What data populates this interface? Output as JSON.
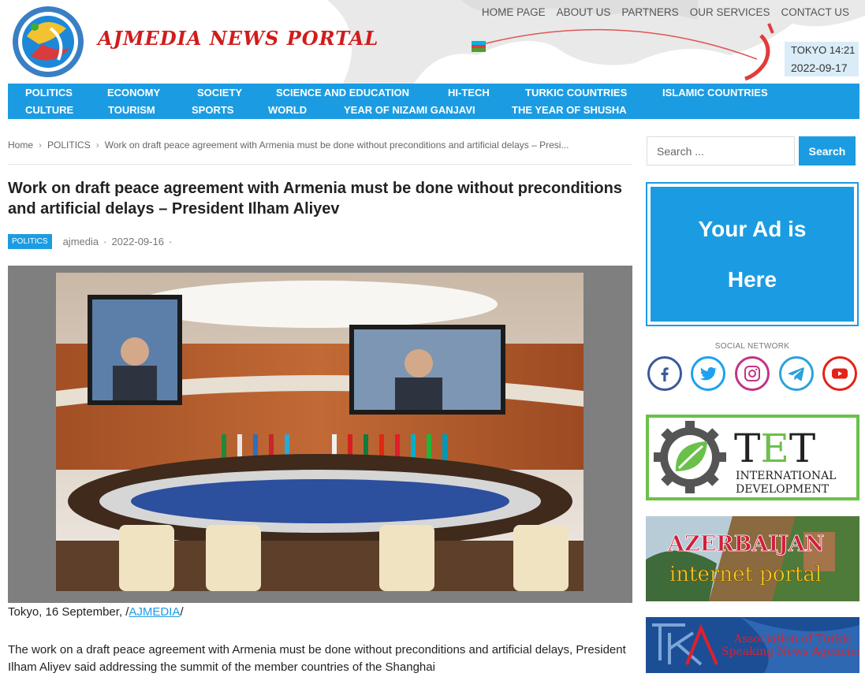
{
  "site": {
    "title": "AJMEDIA NEWS PORTAL",
    "logo_icon": "globe-logo-icon"
  },
  "top_nav": [
    "HOME PAGE",
    "ABOUT US",
    "PARTNERS",
    "OUR SERVICES",
    "CONTACT US"
  ],
  "clock": {
    "city_time": "TOKYO 14:21",
    "date": "2022-09-17"
  },
  "categories": [
    "POLITICS",
    "ECONOMY",
    "SOCIETY",
    "SCIENCE AND EDUCATION",
    "HI-TECH",
    "TURKIC COUNTRIES",
    "ISLAMIC COUNTRIES",
    "CULTURE",
    "TOURISM",
    "SPORTS",
    "WORLD",
    "YEAR OF NIZAMI GANJAVI",
    "THE YEAR OF SHUSHA"
  ],
  "breadcrumb": {
    "home": "Home",
    "section": "POLITICS",
    "current": "Work on draft peace agreement with Armenia must be done without preconditions and artificial delays – Presi..."
  },
  "article": {
    "title": "Work on draft peace agreement with Armenia must be done without preconditions and artificial delays – President Ilham Aliyev",
    "category": "POLITICS",
    "author": "ajmedia",
    "date": "2022-09-16",
    "sep": "·",
    "caption_prefix": "Tokyo, 16 September, /",
    "caption_link": "AJMEDIA",
    "caption_suffix": "/",
    "body": "The work on a draft peace agreement with Armenia must be done without preconditions and artificial delays, President Ilham Aliyev said addressing the summit of the member countries of the Shanghai"
  },
  "sidebar": {
    "search_placeholder": "Search ...",
    "search_button": "Search",
    "ad_text": "Your Ad is Here",
    "social_label": "SOCIAL NETWORK",
    "social": [
      {
        "name": "facebook-icon",
        "color": "#3b5998",
        "glyph": "f"
      },
      {
        "name": "twitter-icon",
        "color": "#1da1f2",
        "glyph": "t"
      },
      {
        "name": "instagram-icon",
        "color": "#c13584",
        "glyph": "ig"
      },
      {
        "name": "telegram-icon",
        "color": "#2aa3dc",
        "glyph": "tg"
      },
      {
        "name": "youtube-icon",
        "color": "#e62117",
        "glyph": "yt"
      }
    ],
    "banners": {
      "tet_word": "TET",
      "tet_line1": "INTERNATIONAL",
      "tet_line2": "DEVELOPMENT",
      "azn_line1": "AZERBAIJAN",
      "azn_line2": "internet portal",
      "tka_logo": "TKA",
      "tka_line1": "Association of Turkic",
      "tka_line2": "Speaking News Agencies"
    }
  },
  "colors": {
    "accent": "#1b9ce2",
    "title_red": "#d11c1c",
    "tet_green": "#6bc04b"
  }
}
